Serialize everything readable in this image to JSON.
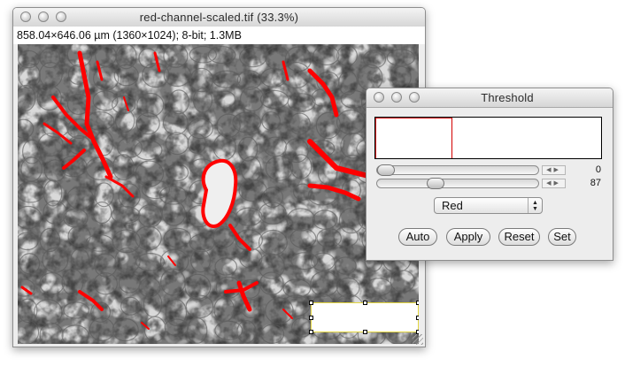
{
  "image_window": {
    "title": "red-channel-scaled.tif (33.3%)",
    "info": "858.04×646.06 µm (1360×1024); 8-bit; 1.3MB"
  },
  "threshold_window": {
    "title": "Threshold",
    "slider_min": {
      "value": "0",
      "fraction": 0.0
    },
    "slider_max": {
      "value": "87",
      "fraction": 0.34
    },
    "channel_select": {
      "value": "Red",
      "options": [
        "Red"
      ]
    },
    "buttons": {
      "auto": "Auto",
      "apply": "Apply",
      "reset": "Reset",
      "set": "Set"
    },
    "histogram": {
      "threshold_fraction": 0.34,
      "highlight_color": "#d40000"
    }
  },
  "colors": {
    "threshold_overlay": "#ff0000",
    "roi_border": "#e3d640"
  }
}
